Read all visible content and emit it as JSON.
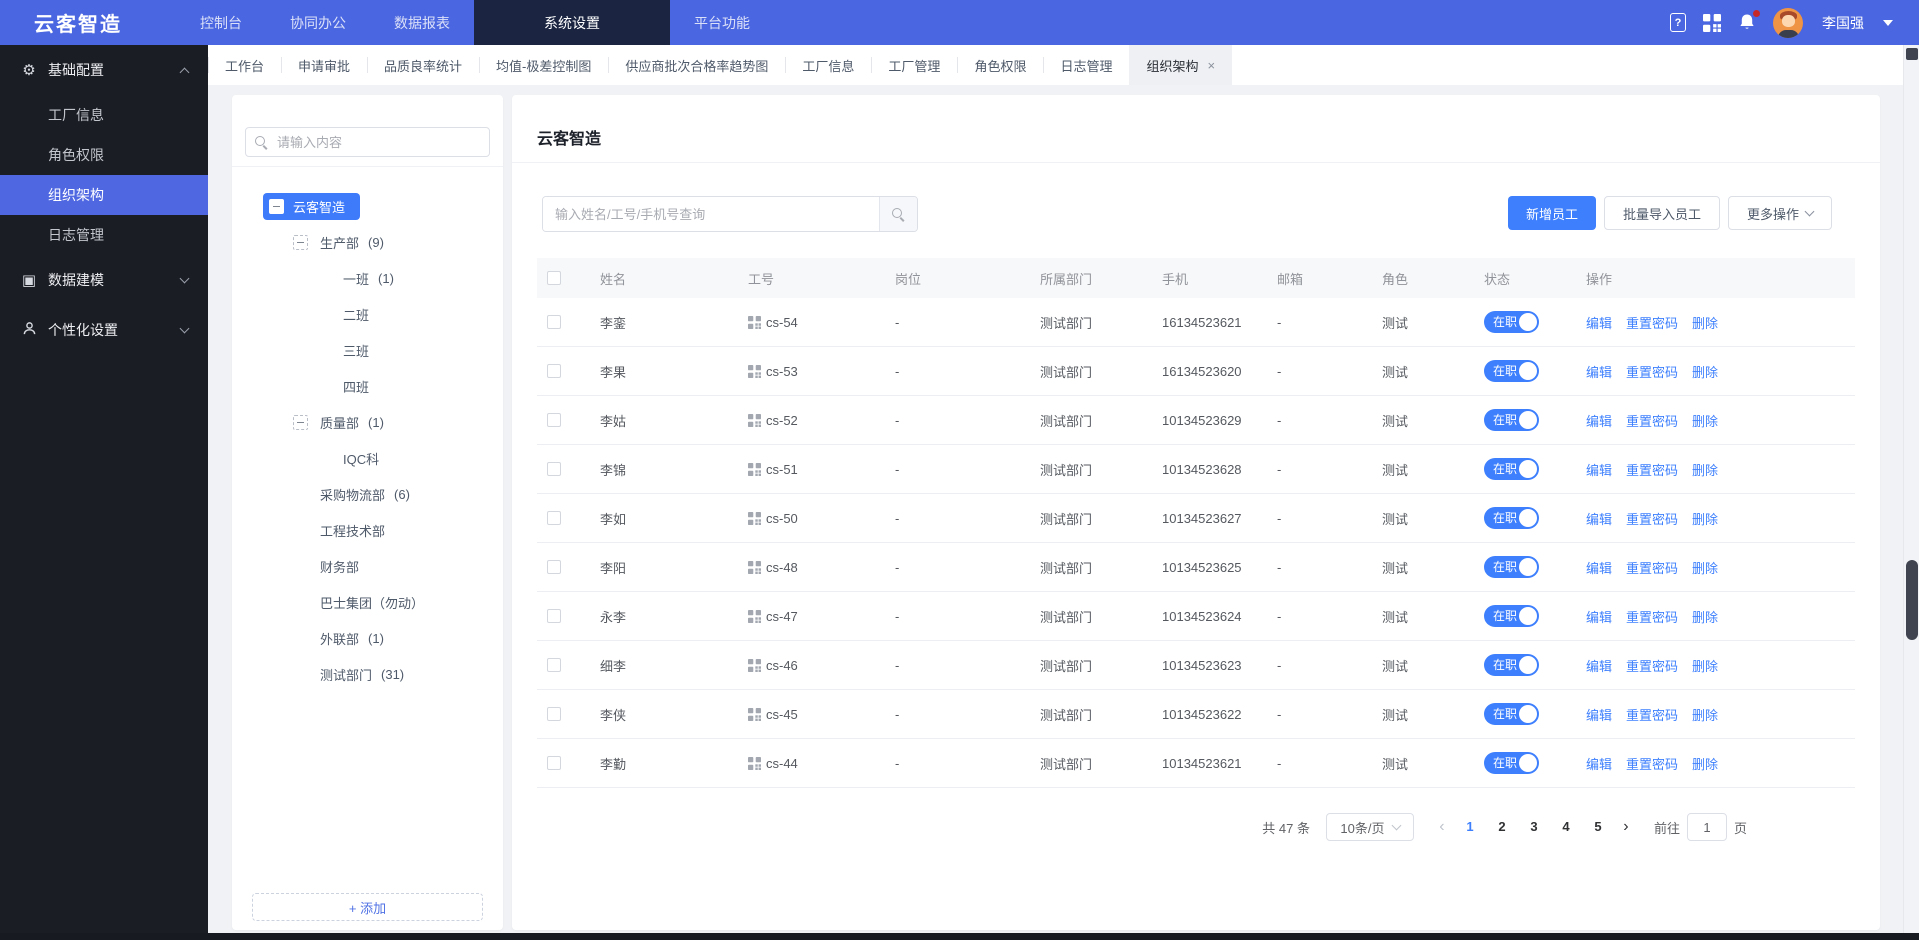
{
  "colors": {
    "navbar_bg": "#4a66e0",
    "navbar_active_bg": "#1b2440",
    "sidebar_bg": "#1b1d24",
    "sidebar_active_bg": "#4f68e2",
    "accent_blue": "#3d7ffd",
    "tree_selected_bg": "#3e7bfa",
    "page_bg": "#f0f2f5"
  },
  "navbar": {
    "logo": "云客智造",
    "items": [
      {
        "label": "控制台",
        "active": false
      },
      {
        "label": "协同办公",
        "active": false
      },
      {
        "label": "数据报表",
        "active": false
      },
      {
        "label": "系统设置",
        "active": true
      },
      {
        "label": "平台功能",
        "active": false
      }
    ],
    "help_icon": "?",
    "user_name": "李国强",
    "has_notification_dot": true
  },
  "tabbar": {
    "tabs": [
      {
        "label": "工作台",
        "active": false,
        "closable": false
      },
      {
        "label": "申请审批",
        "active": false,
        "closable": false
      },
      {
        "label": "品质良率统计",
        "active": false,
        "closable": false
      },
      {
        "label": "均值-极差控制图",
        "active": false,
        "closable": false
      },
      {
        "label": "供应商批次合格率趋势图",
        "active": false,
        "closable": false
      },
      {
        "label": "工厂信息",
        "active": false,
        "closable": false
      },
      {
        "label": "工厂管理",
        "active": false,
        "closable": false
      },
      {
        "label": "角色权限",
        "active": false,
        "closable": false
      },
      {
        "label": "日志管理",
        "active": false,
        "closable": false
      },
      {
        "label": "组织架构",
        "active": true,
        "closable": true
      }
    ],
    "close_glyph": "×"
  },
  "sidebar": {
    "groups": [
      {
        "label": "基础配置",
        "icon": "gear-icon",
        "state": "expanded",
        "children": [
          {
            "label": "工厂信息",
            "active": false
          },
          {
            "label": "角色权限",
            "active": false
          },
          {
            "label": "组织架构",
            "active": true
          },
          {
            "label": "日志管理",
            "active": false
          }
        ]
      },
      {
        "label": "数据建模",
        "icon": "data-model-icon",
        "state": "collapsed",
        "children": []
      },
      {
        "label": "个性化设置",
        "icon": "user-settings-icon",
        "state": "collapsed",
        "children": []
      }
    ]
  },
  "tree_panel": {
    "search_placeholder": "请输入内容",
    "nodes": [
      {
        "label": "云客智造",
        "count": "",
        "level": 0,
        "selected": true,
        "toggle": true
      },
      {
        "label": "生产部",
        "count": "(9)",
        "level": 1,
        "selected": false,
        "toggle": true
      },
      {
        "label": "一班",
        "count": "(1)",
        "level": 2,
        "selected": false,
        "toggle": false
      },
      {
        "label": "二班",
        "count": "",
        "level": 2,
        "selected": false,
        "toggle": false
      },
      {
        "label": "三班",
        "count": "",
        "level": 2,
        "selected": false,
        "toggle": false
      },
      {
        "label": "四班",
        "count": "",
        "level": 2,
        "selected": false,
        "toggle": false
      },
      {
        "label": "质量部",
        "count": "(1)",
        "level": 1,
        "selected": false,
        "toggle": true
      },
      {
        "label": "IQC科",
        "count": "",
        "level": 2,
        "selected": false,
        "toggle": false
      },
      {
        "label": "采购物流部",
        "count": "(6)",
        "level": 1,
        "selected": false,
        "toggle": false
      },
      {
        "label": "工程技术部",
        "count": "",
        "level": 1,
        "selected": false,
        "toggle": false
      },
      {
        "label": "财务部",
        "count": "",
        "level": 1,
        "selected": false,
        "toggle": false
      },
      {
        "label": "巴士集团（勿动）",
        "count": "",
        "level": 1,
        "selected": false,
        "toggle": false
      },
      {
        "label": "外联部",
        "count": "(1)",
        "level": 1,
        "selected": false,
        "toggle": false
      },
      {
        "label": "测试部门",
        "count": "(31)",
        "level": 1,
        "selected": false,
        "toggle": false
      }
    ],
    "add_button": "+ 添加"
  },
  "main": {
    "title": "云客智造",
    "search": {
      "placeholder": "输入姓名/工号/手机号查询"
    },
    "toolbar": {
      "add": "新增员工",
      "bulk_import": "批量导入员工",
      "more": "更多操作"
    },
    "table": {
      "columns": [
        "姓名",
        "工号",
        "岗位",
        "所属部门",
        "手机",
        "邮箱",
        "角色",
        "状态",
        "操作"
      ],
      "actions": [
        "编辑",
        "重置密码",
        "删除"
      ],
      "rows": [
        {
          "name": "李銮",
          "work_id": "cs-54",
          "post": "-",
          "dept": "测试部门",
          "phone": "16134523621",
          "email": "-",
          "role": "测试",
          "status": "在职"
        },
        {
          "name": "李果",
          "work_id": "cs-53",
          "post": "-",
          "dept": "测试部门",
          "phone": "16134523620",
          "email": "-",
          "role": "测试",
          "status": "在职"
        },
        {
          "name": "李姑",
          "work_id": "cs-52",
          "post": "-",
          "dept": "测试部门",
          "phone": "10134523629",
          "email": "-",
          "role": "测试",
          "status": "在职"
        },
        {
          "name": "李锦",
          "work_id": "cs-51",
          "post": "-",
          "dept": "测试部门",
          "phone": "10134523628",
          "email": "-",
          "role": "测试",
          "status": "在职"
        },
        {
          "name": "李如",
          "work_id": "cs-50",
          "post": "-",
          "dept": "测试部门",
          "phone": "10134523627",
          "email": "-",
          "role": "测试",
          "status": "在职"
        },
        {
          "name": "李阳",
          "work_id": "cs-48",
          "post": "-",
          "dept": "测试部门",
          "phone": "10134523625",
          "email": "-",
          "role": "测试",
          "status": "在职"
        },
        {
          "name": "永李",
          "work_id": "cs-47",
          "post": "-",
          "dept": "测试部门",
          "phone": "10134523624",
          "email": "-",
          "role": "测试",
          "status": "在职"
        },
        {
          "name": "细李",
          "work_id": "cs-46",
          "post": "-",
          "dept": "测试部门",
          "phone": "10134523623",
          "email": "-",
          "role": "测试",
          "status": "在职"
        },
        {
          "name": "李侠",
          "work_id": "cs-45",
          "post": "-",
          "dept": "测试部门",
          "phone": "10134523622",
          "email": "-",
          "role": "测试",
          "status": "在职"
        },
        {
          "name": "李勤",
          "work_id": "cs-44",
          "post": "-",
          "dept": "测试部门",
          "phone": "10134523621",
          "email": "-",
          "role": "测试",
          "status": "在职"
        }
      ]
    },
    "pagination": {
      "total": "共 47 条",
      "page_size": "10条/页",
      "pages": [
        "1",
        "2",
        "3",
        "4",
        "5"
      ],
      "current": "1",
      "prev_glyph": "‹",
      "next_glyph": "›",
      "goto_label": "前往",
      "goto_value": "1",
      "goto_unit": "页"
    }
  }
}
